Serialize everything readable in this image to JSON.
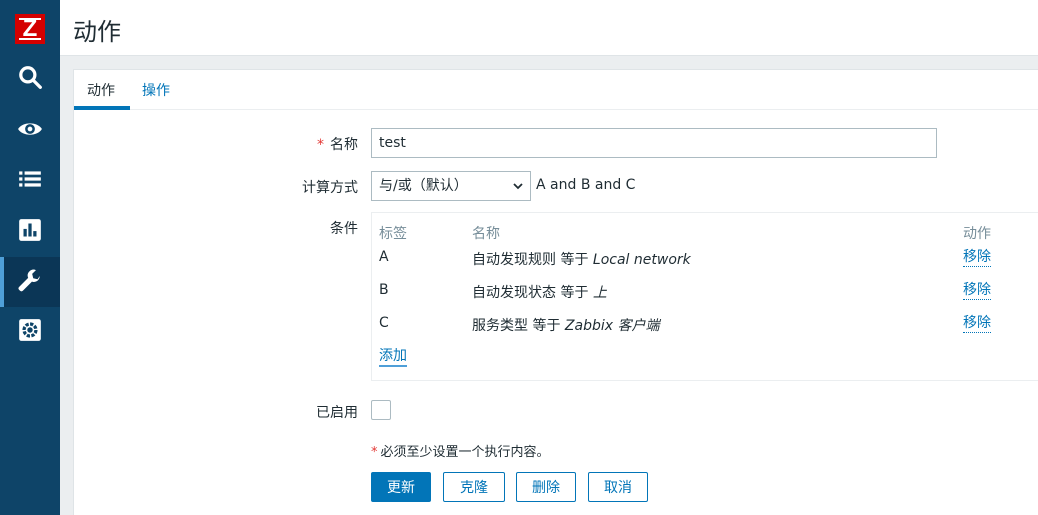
{
  "page": {
    "title": "动作"
  },
  "sidebar": {
    "logo_letter": "Z"
  },
  "tabs": [
    {
      "label": "动作"
    },
    {
      "label": "操作"
    }
  ],
  "form": {
    "name_label": "名称",
    "name_value": "test",
    "calc_label": "计算方式",
    "calc_value": "与/或（默认）",
    "formula": "A and B and C",
    "conditions_label": "条件",
    "enabled_label": "已启用",
    "enabled": false,
    "required_mark": "*",
    "note": "必须至少设置一个执行内容。"
  },
  "conditions": {
    "headers": {
      "label": "标签",
      "name": "名称",
      "action": "动作"
    },
    "rows": [
      {
        "label": "A",
        "name_prefix": "自动发现规则 等于 ",
        "name_value": "Local network",
        "action": "移除"
      },
      {
        "label": "B",
        "name_prefix": "自动发现状态 等于 ",
        "name_value": "上",
        "action": "移除"
      },
      {
        "label": "C",
        "name_prefix": "服务类型 等于 ",
        "name_value": "Zabbix 客户端",
        "action": "移除"
      }
    ],
    "add_label": "添加"
  },
  "buttons": {
    "update": "更新",
    "clone": "克隆",
    "delete": "删除",
    "cancel": "取消"
  },
  "colors": {
    "sidebar": "#0e4468",
    "accent": "#0275b8",
    "logo": "#d40000",
    "required": "#e33734"
  }
}
